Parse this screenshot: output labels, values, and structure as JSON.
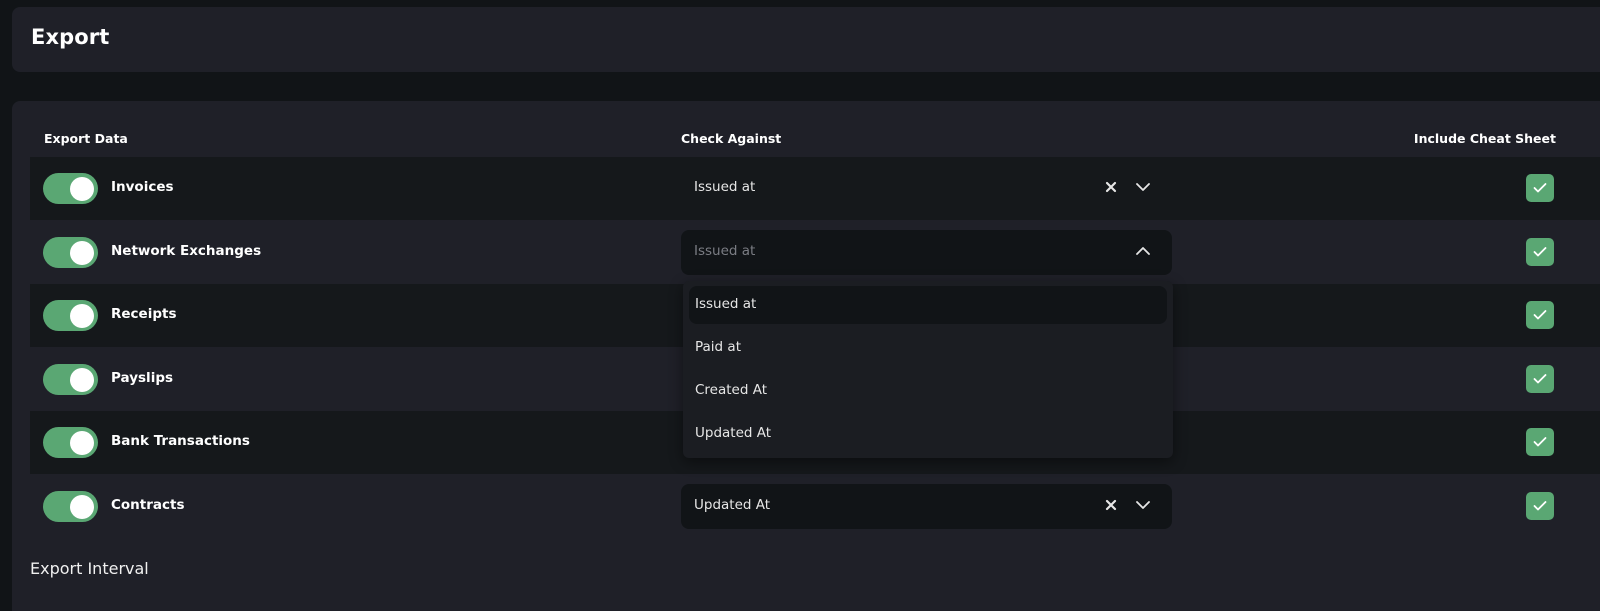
{
  "header": {
    "title": "Export"
  },
  "columns": {
    "export_data": "Export Data",
    "check_against": "Check Against",
    "include_cheat_sheet": "Include Cheat Sheet"
  },
  "rows": [
    {
      "label": "Invoices",
      "enabled": true,
      "check_against": "Issued at",
      "cheat_sheet": true
    },
    {
      "label": "Network Exchanges",
      "enabled": true,
      "check_against": "",
      "placeholder": "Issued at",
      "cheat_sheet": true,
      "dropdown_open": true
    },
    {
      "label": "Receipts",
      "enabled": true,
      "cheat_sheet": true
    },
    {
      "label": "Payslips",
      "enabled": true,
      "cheat_sheet": true
    },
    {
      "label": "Bank Transactions",
      "enabled": true,
      "cheat_sheet": true
    },
    {
      "label": "Contracts",
      "enabled": true,
      "check_against": "Updated At",
      "cheat_sheet": true
    }
  ],
  "dropdown": {
    "options": [
      "Issued at",
      "Paid at",
      "Created At",
      "Updated At"
    ],
    "highlighted": "Issued at"
  },
  "sections": {
    "export_interval": "Export Interval"
  },
  "colors": {
    "accent": "#5aa773",
    "card": "#1f2028",
    "row_dark": "#15181b",
    "background": "#111417"
  },
  "icons": {
    "clear": "close-icon",
    "expand": "chevron-down-icon",
    "collapse": "chevron-up-icon",
    "check": "check-icon"
  }
}
